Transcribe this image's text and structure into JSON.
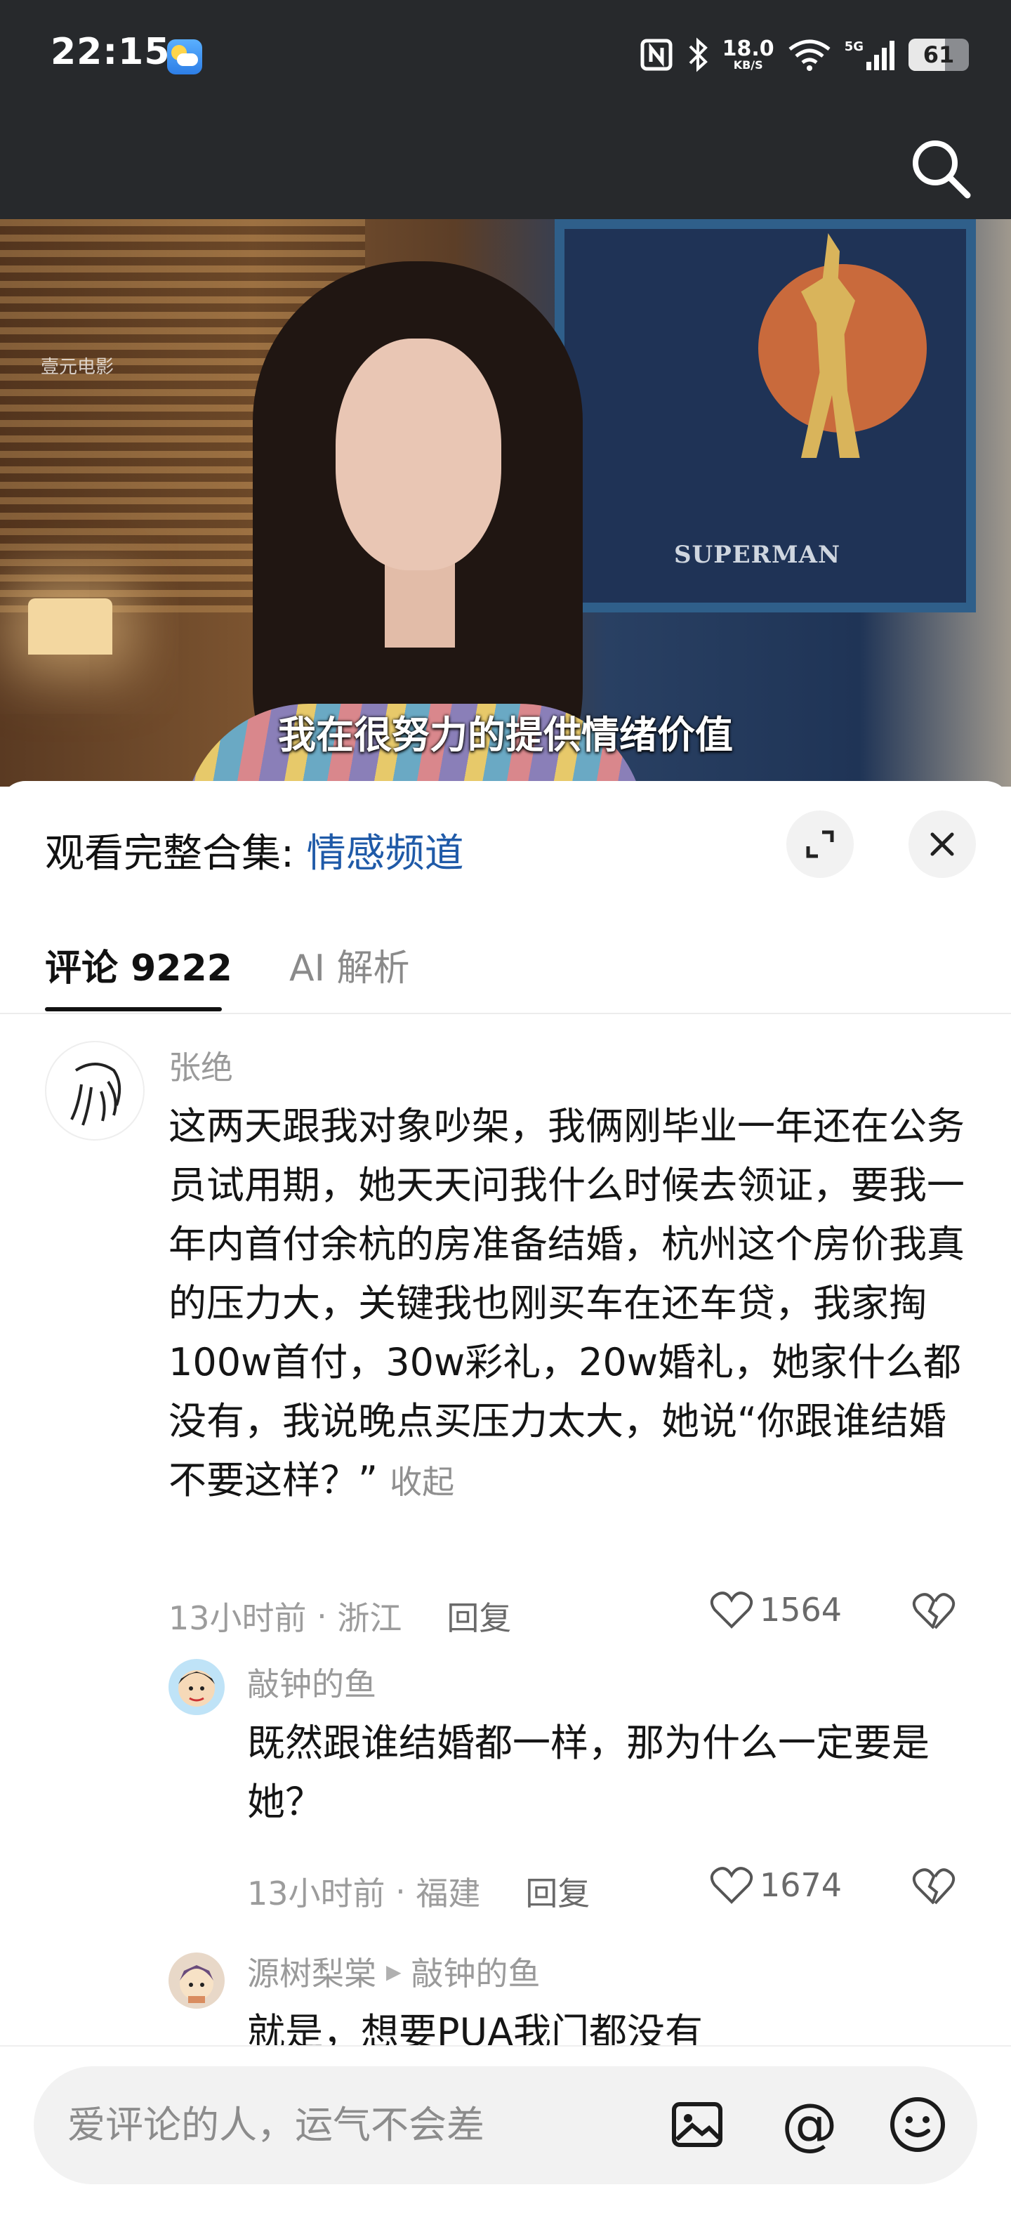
{
  "status_bar": {
    "time": "22:15",
    "net_speed_value": "18.0",
    "net_speed_unit": "KB/S",
    "signal_label": "5G",
    "battery_level": "61",
    "battery_fraction": 0.61
  },
  "video": {
    "watermark": "壹元电影",
    "wall_text": "SUPERMAN",
    "subtitle": "我在很努力的提供情绪价值"
  },
  "panel": {
    "title_prefix": "观看完整合集: ",
    "title_link": "情感频道"
  },
  "tabs": [
    {
      "label": "评论 9222",
      "active": true
    },
    {
      "label": "AI 解析",
      "active": false
    }
  ],
  "comments": [
    {
      "username": "张绝",
      "text": "这两天跟我对象吵架，我俩刚毕业一年还在公务员试用期，她天天问我什么时候去领证，要我一年内首付余杭的房准备结婚，杭州这个房价我真的压力大，关键我也刚买车在还车贷，我家掏100w首付，30w彩礼，20w婚礼，她家什么都没有，我说晚点买压力太大，她说“你跟谁结婚不要这样？”",
      "collapse_label": "收起",
      "time": "13小时前",
      "location": "浙江",
      "reply_label": "回复",
      "likes": "1564"
    },
    {
      "username": "敲钟的鱼",
      "text": "既然跟谁结婚都一样，那为什么一定要是她？",
      "time": "13小时前",
      "location": "福建",
      "reply_label": "回复",
      "likes": "1674"
    },
    {
      "username": "源树梨棠",
      "reply_to": "敲钟的鱼",
      "text": "就是，想要PUA我门都没有"
    }
  ],
  "input": {
    "placeholder": "爱评论的人，运气不会差",
    "at_symbol": "@"
  }
}
